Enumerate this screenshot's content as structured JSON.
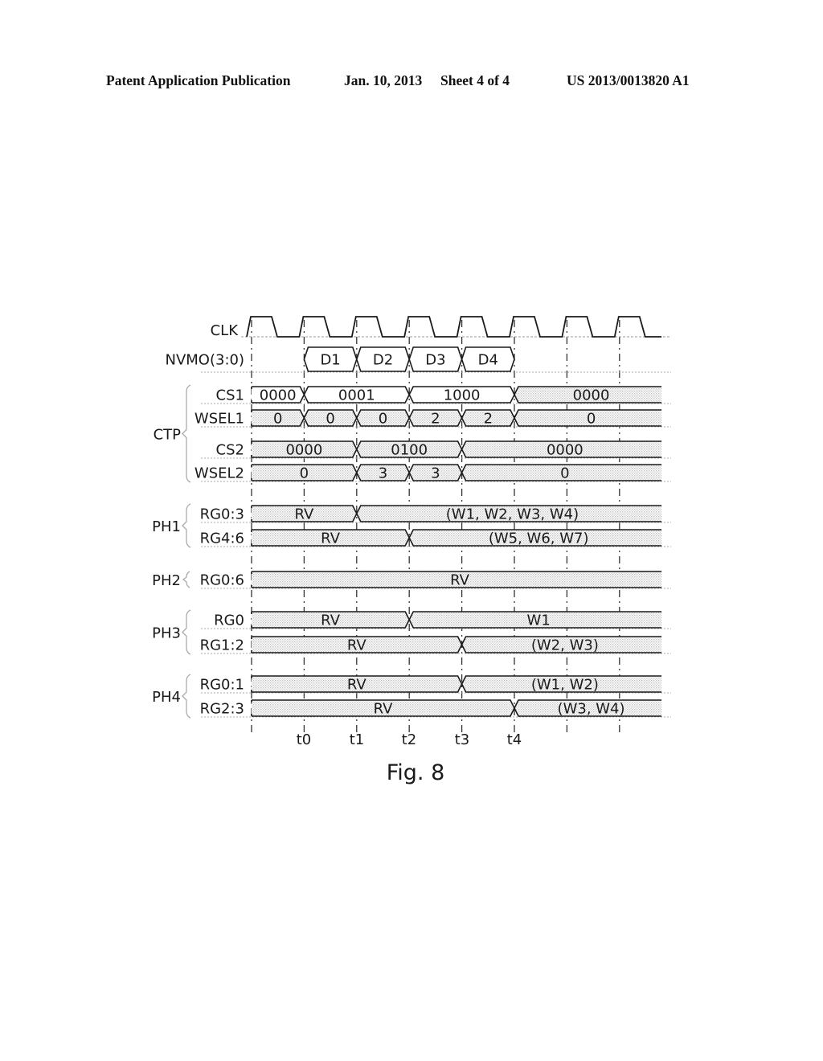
{
  "header": {
    "left": "Patent Application Publication",
    "center": "Jan. 10, 2013",
    "sheet": "Sheet 4 of 4",
    "right": "US 2013/0013820 A1"
  },
  "figure": {
    "caption": "Fig. 8",
    "time_markers": [
      "t0",
      "t1",
      "t2",
      "t3",
      "t4"
    ],
    "clock": {
      "name": "CLK",
      "cycles": 8
    },
    "groups": [
      {
        "name": "CTP",
        "signals": [
          "CS1",
          "WSEL1",
          "CS2",
          "WSEL2"
        ]
      },
      {
        "name": "PH1",
        "signals": [
          "RG0:3",
          "RG4:6"
        ]
      },
      {
        "name": "PH2",
        "signals": [
          "RG0:6"
        ]
      },
      {
        "name": "PH3",
        "signals": [
          "RG0",
          "RG1:2"
        ]
      },
      {
        "name": "PH4",
        "signals": [
          "RG0:1",
          "RG2:3"
        ]
      }
    ],
    "signals": [
      {
        "id": "nvmo",
        "name": "NVMO(3:0)",
        "segments": [
          {
            "from": 1,
            "to": 2,
            "value": "D1",
            "fill": false
          },
          {
            "from": 2,
            "to": 3,
            "value": "D2",
            "fill": false
          },
          {
            "from": 3,
            "to": 4,
            "value": "D3",
            "fill": false
          },
          {
            "from": 4,
            "to": 5,
            "value": "D4",
            "fill": false
          }
        ]
      },
      {
        "id": "cs1",
        "name": "CS1",
        "segments": [
          {
            "from": 0,
            "to": 1,
            "value": "0000",
            "fill": false
          },
          {
            "from": 1,
            "to": 3,
            "value": "0001",
            "fill": false
          },
          {
            "from": 3,
            "to": 5,
            "value": "1000",
            "fill": false
          },
          {
            "from": 5,
            "to": 7.8,
            "value": "0000",
            "fill": true
          }
        ]
      },
      {
        "id": "wsel1",
        "name": "WSEL1",
        "segments": [
          {
            "from": 0,
            "to": 1,
            "value": "0",
            "fill": true
          },
          {
            "from": 1,
            "to": 2,
            "value": "0",
            "fill": true
          },
          {
            "from": 2,
            "to": 3,
            "value": "0",
            "fill": true
          },
          {
            "from": 3,
            "to": 4,
            "value": "2",
            "fill": true
          },
          {
            "from": 4,
            "to": 5,
            "value": "2",
            "fill": true
          },
          {
            "from": 5,
            "to": 7.8,
            "value": "0",
            "fill": true
          }
        ]
      },
      {
        "id": "cs2",
        "name": "CS2",
        "segments": [
          {
            "from": 0,
            "to": 2,
            "value": "0000",
            "fill": true
          },
          {
            "from": 2,
            "to": 4,
            "value": "0100",
            "fill": true
          },
          {
            "from": 4,
            "to": 7.8,
            "value": "0000",
            "fill": true
          }
        ]
      },
      {
        "id": "wsel2",
        "name": "WSEL2",
        "segments": [
          {
            "from": 0,
            "to": 2,
            "value": "0",
            "fill": true
          },
          {
            "from": 2,
            "to": 3,
            "value": "3",
            "fill": true
          },
          {
            "from": 3,
            "to": 4,
            "value": "3",
            "fill": true
          },
          {
            "from": 4,
            "to": 7.8,
            "value": "0",
            "fill": true
          }
        ]
      },
      {
        "id": "ph1-rg03",
        "name": "RG0:3",
        "segments": [
          {
            "from": 0,
            "to": 2,
            "value": "RV",
            "fill": true
          },
          {
            "from": 2,
            "to": 7.8,
            "value": "(W1, W2, W3, W4)",
            "fill": true
          }
        ]
      },
      {
        "id": "ph1-rg46",
        "name": "RG4:6",
        "segments": [
          {
            "from": 0,
            "to": 3,
            "value": "RV",
            "fill": true
          },
          {
            "from": 3,
            "to": 7.8,
            "value": "(W5, W6, W7)",
            "fill": true
          }
        ]
      },
      {
        "id": "ph2-rg06",
        "name": "RG0:6",
        "segments": [
          {
            "from": 0,
            "to": 7.8,
            "value": "RV",
            "fill": true
          }
        ]
      },
      {
        "id": "ph3-rg0",
        "name": "RG0",
        "segments": [
          {
            "from": 0,
            "to": 3,
            "value": "RV",
            "fill": true
          },
          {
            "from": 3,
            "to": 7.8,
            "value": "W1",
            "fill": true
          }
        ]
      },
      {
        "id": "ph3-rg12",
        "name": "RG1:2",
        "segments": [
          {
            "from": 0,
            "to": 4,
            "value": "RV",
            "fill": true
          },
          {
            "from": 4,
            "to": 7.8,
            "value": "(W2, W3)",
            "fill": true
          }
        ]
      },
      {
        "id": "ph4-rg01",
        "name": "RG0:1",
        "segments": [
          {
            "from": 0,
            "to": 4,
            "value": "RV",
            "fill": true
          },
          {
            "from": 4,
            "to": 7.8,
            "value": "(W1, W2)",
            "fill": true
          }
        ]
      },
      {
        "id": "ph4-rg23",
        "name": "RG2:3",
        "segments": [
          {
            "from": 0,
            "to": 5,
            "value": "RV",
            "fill": true
          },
          {
            "from": 5,
            "to": 7.8,
            "value": "(W3, W4)",
            "fill": true
          }
        ]
      }
    ]
  }
}
